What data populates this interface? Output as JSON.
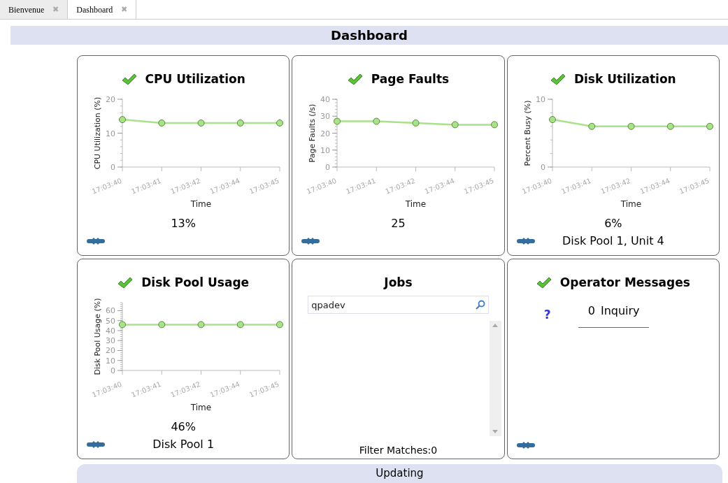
{
  "tabs": [
    {
      "label": "Bienvenue",
      "close": "✖",
      "selected": false
    },
    {
      "label": "Dashboard",
      "close": "✖",
      "selected": true
    }
  ],
  "header": {
    "title": "Dashboard"
  },
  "cards": [
    {
      "kind": "chart",
      "title": "CPU Utilization",
      "ok": true,
      "value": "13%",
      "chart_data": {
        "type": "line",
        "xlabel": "Time",
        "ylabel": "CPU Utilization (%)",
        "categories": [
          "17:03:40",
          "17:03:41",
          "17:03:42",
          "17:03:44",
          "17:03:45"
        ],
        "series": [
          {
            "color": "#a8e28a",
            "marker": "circle",
            "values": [
              14,
              13,
              13,
              13,
              13
            ]
          }
        ],
        "ylim": [
          0,
          20
        ],
        "yticks": [
          0,
          10,
          20
        ]
      }
    },
    {
      "kind": "chart",
      "title": "Page Faults",
      "ok": true,
      "value": "25",
      "chart_data": {
        "type": "line",
        "xlabel": "Time",
        "ylabel": "Page Faults (/s)",
        "categories": [
          "17:03:40",
          "17:03:41",
          "17:03:42",
          "17:03:44",
          "17:03:45"
        ],
        "series": [
          {
            "color": "#a8e28a",
            "marker": "circle",
            "values": [
              27,
              27,
              26,
              25,
              25
            ]
          }
        ],
        "ylim": [
          0,
          40
        ],
        "yticks": [
          0,
          10,
          20,
          30,
          40
        ]
      }
    },
    {
      "kind": "chart",
      "title": "Disk Utilization",
      "ok": true,
      "value": "6%",
      "detail": "Disk Pool 1, Unit 4",
      "chart_data": {
        "type": "line",
        "xlabel": "Time",
        "ylabel": "Percent Busy (%)",
        "categories": [
          "17:03:40",
          "17:03:41",
          "17:03:42",
          "17:03:44",
          "17:03:45"
        ],
        "series": [
          {
            "color": "#a8e28a",
            "marker": "circle",
            "values": [
              7,
              6,
              6,
              6,
              6
            ]
          }
        ],
        "ylim": [
          0,
          10
        ],
        "yticks": [
          0,
          10
        ]
      }
    },
    {
      "kind": "chart",
      "title": "Disk Pool Usage",
      "ok": true,
      "value": "46%",
      "detail": "Disk Pool 1",
      "chart_data": {
        "type": "line",
        "xlabel": "Time",
        "ylabel": "Disk Pool Usage (%)",
        "categories": [
          "17:03:40",
          "17:03:41",
          "17:03:42",
          "17:03:44",
          "17:03:45"
        ],
        "series": [
          {
            "color": "#a8e28a",
            "marker": "circle",
            "values": [
              46,
              46,
              46,
              46,
              46
            ]
          }
        ],
        "ylim": [
          0,
          68
        ],
        "yticks": [
          0,
          10,
          20,
          30,
          40,
          50,
          60
        ]
      }
    },
    {
      "kind": "jobs",
      "title": "Jobs",
      "ok": false,
      "search": {
        "value": "qpadev"
      },
      "footer": "Filter Matches:0"
    },
    {
      "kind": "messages",
      "title": "Operator Messages",
      "ok": true,
      "rows": [
        {
          "icon": "?",
          "count": "0",
          "label": "Inquiry"
        }
      ]
    }
  ],
  "status_bar": {
    "text": "Updating"
  }
}
